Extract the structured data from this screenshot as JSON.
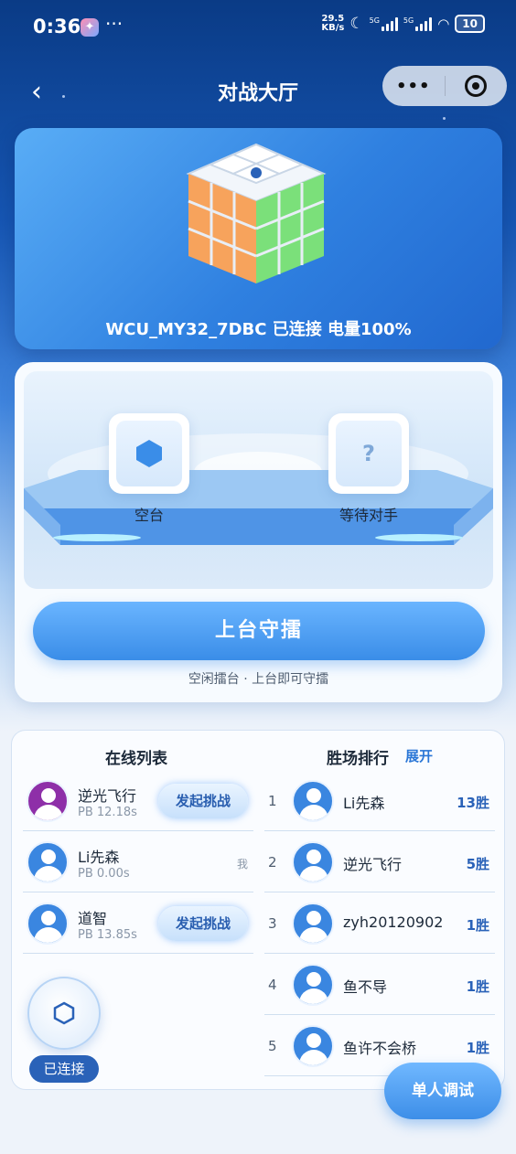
{
  "status_bar": {
    "time": "0:36",
    "speed_value": "29.5",
    "speed_unit": "KB/s",
    "net1": "5G",
    "net2": "5G",
    "battery": "10"
  },
  "nav": {
    "title": "对战大厅",
    "back_icon": "chevron-left-icon",
    "more": "•••"
  },
  "device": {
    "text": "WCU_MY32_7DBC 已连接 电量100%"
  },
  "arena": {
    "slot_left_label": "空台",
    "slot_right_label": "等待对手",
    "slot_right_symbol": "?",
    "main_button": "上台守擂",
    "hint": "空闲擂台 · 上台即可守擂"
  },
  "online": {
    "title": "在线列表",
    "users": [
      {
        "name": "逆光飞行",
        "pb": "PB 12.18s",
        "action": "发起挑战"
      },
      {
        "name": "Li先森",
        "pb": "PB 0.00s",
        "me": "我"
      },
      {
        "name": "道智",
        "pb": "PB 13.85s",
        "action": "发起挑战"
      }
    ]
  },
  "ranking": {
    "title": "胜场排行",
    "expand": "展开",
    "rows": [
      {
        "rank": "1",
        "name": "Li先森",
        "wins": "13胜"
      },
      {
        "rank": "2",
        "name": "逆光飞行",
        "wins": "5胜"
      },
      {
        "rank": "3",
        "name": "zyh20120902",
        "wins": "1胜"
      },
      {
        "rank": "4",
        "name": "鱼不导",
        "wins": "1胜"
      },
      {
        "rank": "5",
        "name": "鱼许不会桥",
        "wins": "1胜"
      }
    ]
  },
  "connection": {
    "label": "已连接"
  },
  "single_debug": {
    "label": "单人调试"
  },
  "colors": {
    "accent": "#3a8de8",
    "dark_blue": "#2a62b8",
    "header_top": "#0a3b86"
  }
}
